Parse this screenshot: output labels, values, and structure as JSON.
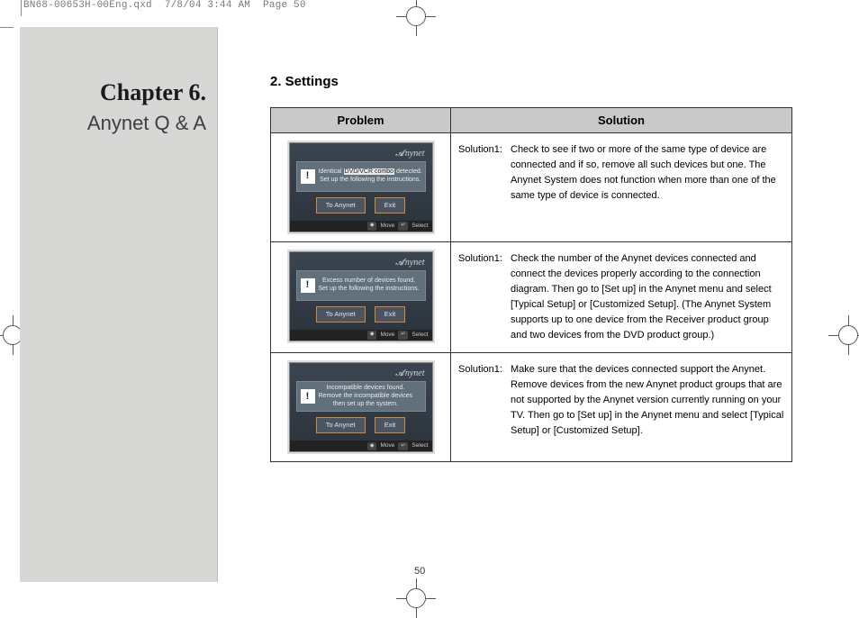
{
  "header": {
    "filename": "BN68-00653H-00Eng.qxd",
    "datetime": "7/8/04 3:44 AM",
    "pagelabel": "Page 50"
  },
  "sidebar": {
    "chapter": "Chapter 6.",
    "subtitle": "Anynet Q & A"
  },
  "section": {
    "title": "2. Settings"
  },
  "table": {
    "head_problem": "Problem",
    "head_solution": "Solution"
  },
  "thumbs": {
    "logo": "nynet",
    "toAnynet": "To Anynet",
    "exit": "Exit",
    "move": "Move",
    "select": "Select",
    "r1_line1a": "Identical",
    "r1_line1b": "DVD/VCR combo",
    "r1_line1c": "detected.",
    "r1_line2": "Set up the following the instructions.",
    "r2_line1": "Excess number of devices found.",
    "r2_line2": "Set up the following the instructions.",
    "r3_line1": "Incompatible devices found.",
    "r3_line2": "Remove the incompatible devices",
    "r3_line3": "then set up the system."
  },
  "solutions": {
    "label": "Solution1:",
    "r1": "Check to see if two or more of the same type of device are connected and if so, remove all such devices but one. The Anynet System does not function when more than one of the same type of device is connected.",
    "r2": "Check the number of the Anynet devices connected and connect the devices properly according to the connection diagram. Then go to [Set up] in the Anynet menu and select [Typical Setup] or [Customized Setup]. (The Anynet System supports up to one device from the Receiver product group and two devices from the DVD product group.)",
    "r3": "Make sure that the devices connected support the Anynet. Remove devices from the new Anynet product groups that are not supported by the Anynet version currently running on your TV. Then go to [Set up] in the Anynet menu and select [Typical Setup] or [Customized Setup]."
  },
  "pageno": "50"
}
